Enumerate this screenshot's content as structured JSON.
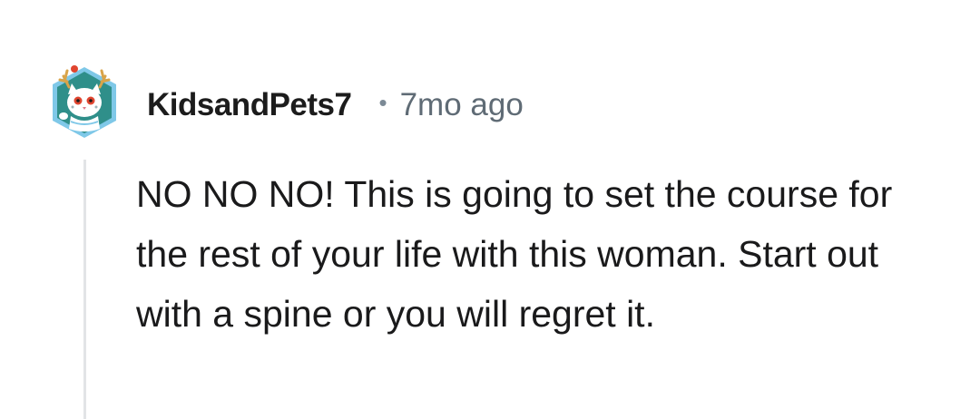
{
  "comment": {
    "author": "KidsandPets7",
    "separator": "•",
    "timestamp": "7mo ago",
    "body": "NO NO NO! This is going to set the course for the rest of your life with this woman. Start out with a spine or you will regret it."
  },
  "avatar": {
    "icon": "snow-leopard-avatar-icon",
    "colors": {
      "hex_fill": "#2f8f8a",
      "hex_border": "#7fc8e8",
      "antler": "#d9a44a",
      "face": "#ffffff",
      "accent": "#e0452f"
    }
  },
  "colors": {
    "username": "#1c1c1c",
    "timestamp": "#5f6b75",
    "body_text": "#1a1a1b",
    "thread_line": "#e2e4e6"
  }
}
